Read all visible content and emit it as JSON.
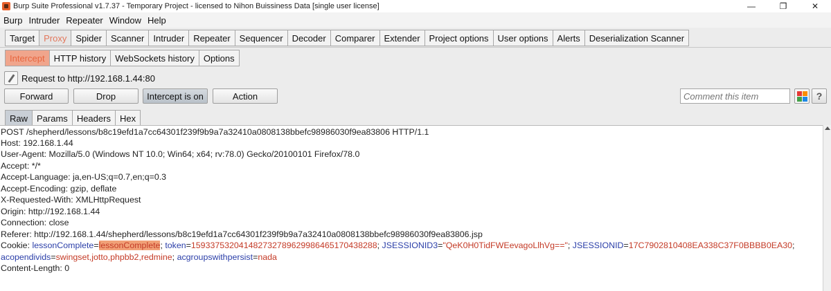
{
  "window": {
    "title": "Burp Suite Professional v1.7.37 - Temporary Project - licensed to Nihon Buissiness Data [single user license]",
    "controls": {
      "minimize": "—",
      "maximize": "❐",
      "close": "✕"
    }
  },
  "menu": [
    "Burp",
    "Intruder",
    "Repeater",
    "Window",
    "Help"
  ],
  "main_tabs": [
    "Target",
    "Proxy",
    "Spider",
    "Scanner",
    "Intruder",
    "Repeater",
    "Sequencer",
    "Decoder",
    "Comparer",
    "Extender",
    "Project options",
    "User options",
    "Alerts",
    "Deserialization Scanner"
  ],
  "main_tabs_active": "Proxy",
  "proxy_tabs": [
    "Intercept",
    "HTTP history",
    "WebSockets history",
    "Options"
  ],
  "proxy_tabs_active": "Intercept",
  "request_label": "Request to http://192.168.1.44:80",
  "buttons": {
    "forward": "Forward",
    "drop": "Drop",
    "intercept": "Intercept is on",
    "action": "Action"
  },
  "comment_placeholder": "Comment this item",
  "help_label": "?",
  "view_tabs": [
    "Raw",
    "Params",
    "Headers",
    "Hex"
  ],
  "view_tabs_active": "Raw",
  "accent_color": "#e8653e",
  "request_lines": [
    "POST /shepherd/lessons/b8c19efd1a7cc64301f239f9b9a7a32410a0808138bbefc98986030f9ea83806 HTTP/1.1",
    "Host: 192.168.1.44",
    "User-Agent: Mozilla/5.0 (Windows NT 10.0; Win64; x64; rv:78.0) Gecko/20100101 Firefox/78.0",
    "Accept: */*",
    "Accept-Language: ja,en-US;q=0.7,en;q=0.3",
    "Accept-Encoding: gzip, deflate",
    "X-Requested-With: XMLHttpRequest",
    "Origin: http://192.168.1.44",
    "Connection: close",
    "Referer: http://192.168.1.44/shepherd/lessons/b8c19efd1a7cc64301f239f9b9a7a32410a0808138bbefc98986030f9ea83806.jsp"
  ],
  "cookie": {
    "prefix": "Cookie: ",
    "k1": "lessonComplete",
    "eq1": "=",
    "v1": "lessonComplete",
    "sep1": "; ",
    "k2": "token",
    "eq2": "=",
    "v2": "159337532041482732789629986465170438288",
    "sep2": "; ",
    "k3": "JSESSIONID3",
    "eq3": "=",
    "v3": "\"QeK0H0TidFWEevagoLlhVg==\"",
    "sep3": "; ",
    "k4": "JSESSIONID",
    "eq4": "=",
    "v4": "17C7902810408EA338C37F0BBBB0EA30",
    "sep4": ";",
    "k5": "acopendivids",
    "eq5": "=",
    "v5": "swingset,jotto,phpbb2,redmine",
    "sep5": "; ",
    "k6": "acgroupswithpersist",
    "eq6": "=",
    "v6": "nada"
  },
  "content_length": "Content-Length: 0"
}
